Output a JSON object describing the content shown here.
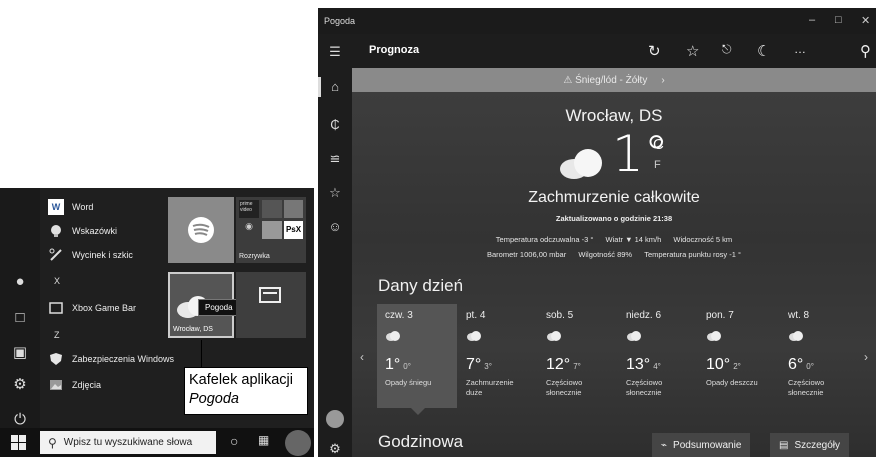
{
  "start_menu": {
    "apps": [
      {
        "label": "Word",
        "icon": "word-icon"
      },
      {
        "label": "Wskazówki",
        "icon": "tips-icon"
      },
      {
        "label": "Wycinek i szkic",
        "icon": "snip-icon"
      },
      {
        "label": "Xbox Game Bar",
        "icon": "xbox-icon"
      },
      {
        "label": "Zabezpieczenia Windows",
        "icon": "shield-icon"
      },
      {
        "label": "Zdjęcia",
        "icon": "photos-icon"
      }
    ],
    "letters": [
      "X",
      "Z"
    ],
    "tiles": {
      "entertainment_label": "Rozrywka",
      "weather_label": "Wrocław, DS",
      "weather_tooltip": "Pogoda",
      "psx_label": "PsX",
      "prime_label": "prime video"
    },
    "search_placeholder": "Wpisz tu wyszukiwane słowa"
  },
  "callout": {
    "line1": "Kafelek aplikacji",
    "line2": "Pogoda"
  },
  "weather": {
    "window_title": "Pogoda",
    "header": "Prognoza",
    "alert": "⚠  Śnieg/lód - Żółty",
    "city": "Wrocław, DS",
    "temperature": "1°",
    "unit_c": "C",
    "unit_f": "F",
    "condition": "Zachmurzenie całkowite",
    "updated": "Zaktualizowano o godzinie 21:38",
    "details_line1": [
      "Temperatura odczuwalna  -3 °",
      "Wiatr  ▼ 14 km/h",
      "Widoczność  5 km"
    ],
    "details_line2": [
      "Barometr  1006,00 mbar",
      "Wilgotność  89%",
      "Temperatura punktu rosy  -1 °"
    ],
    "daily_title": "Dany dzień",
    "days": [
      {
        "name": "czw. 3",
        "hi": "1°",
        "lo": "0°",
        "desc": "Opady śniegu"
      },
      {
        "name": "pt. 4",
        "hi": "7°",
        "lo": "3°",
        "desc": "Zachmurzenie duże"
      },
      {
        "name": "sob. 5",
        "hi": "12°",
        "lo": "7°",
        "desc": "Częściowo słonecznie"
      },
      {
        "name": "niedz. 6",
        "hi": "13°",
        "lo": "4°",
        "desc": "Częściowo słonecznie"
      },
      {
        "name": "pon. 7",
        "hi": "10°",
        "lo": "2°",
        "desc": "Opady deszczu"
      },
      {
        "name": "wt. 8",
        "hi": "6°",
        "lo": "0°",
        "desc": "Częściowo słonecznie"
      }
    ],
    "hourly_title": "Godzinowa",
    "summary_button": "Podsumowanie",
    "details_button": "Szczegóły"
  }
}
